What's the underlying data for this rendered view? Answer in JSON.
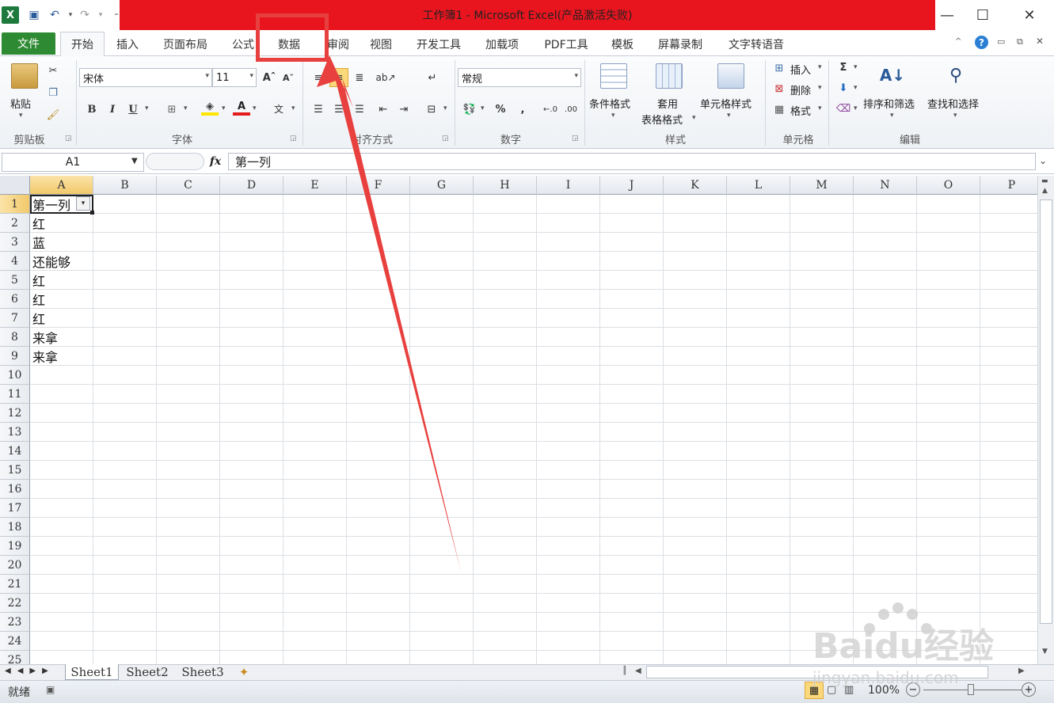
{
  "titlebar": {
    "title": "工作簿1 - Microsoft Excel(产品激活失败)",
    "minimize": "—",
    "maximize": "☐",
    "close": "✕"
  },
  "tabs": [
    "文件",
    "开始",
    "插入",
    "页面布局",
    "公式",
    "数据",
    "审阅",
    "视图",
    "开发工具",
    "加载项",
    "PDF工具",
    "模板",
    "屏幕录制",
    "文字转语音"
  ],
  "ribbon": {
    "clipboard": {
      "paste": "粘贴",
      "group": "剪贴板"
    },
    "font": {
      "name": "宋体",
      "size": "11",
      "group": "字体",
      "bold": "B",
      "italic": "I",
      "underline": "U"
    },
    "align": {
      "group": "对齐方式"
    },
    "number": {
      "format": "常规",
      "group": "数字",
      "percent": "%",
      "comma": ","
    },
    "styles": {
      "cond": "条件格式",
      "table_1": "套用",
      "table_2": "表格格式",
      "cell": "单元格样式",
      "group": "样式"
    },
    "cells": {
      "insert": "插入",
      "delete": "删除",
      "format": "格式",
      "group": "单元格"
    },
    "editing": {
      "sort": "排序和筛选",
      "find": "查找和选择",
      "group": "编辑",
      "sum": "Σ"
    }
  },
  "formula_bar": {
    "name_box": "A1",
    "fx": "fx",
    "content": "第一列"
  },
  "columns": [
    "A",
    "B",
    "C",
    "D",
    "E",
    "F",
    "G",
    "H",
    "I",
    "J",
    "K",
    "L",
    "M",
    "N",
    "O",
    "P"
  ],
  "rows": [
    "1",
    "2",
    "3",
    "4",
    "5",
    "6",
    "7",
    "8",
    "9",
    "10",
    "11",
    "12",
    "13",
    "14",
    "15",
    "16",
    "17",
    "18",
    "19",
    "20",
    "21",
    "22",
    "23",
    "24",
    "25"
  ],
  "cells_a": [
    "第一列",
    "红",
    "蓝",
    "还能够",
    "红",
    "红",
    "红",
    "来拿",
    "来拿"
  ],
  "sheets": [
    "Sheet1",
    "Sheet2",
    "Sheet3"
  ],
  "status": {
    "ready": "就绪",
    "zoom": "100%",
    "minus": "−",
    "plus": "+"
  },
  "watermark": {
    "brand": "Baidu经验",
    "url": "jingyan.baidu.com"
  },
  "colors": {
    "title_red": "#e8141e",
    "file_tab": "#2f8b33",
    "highlight": "#e8403e"
  }
}
